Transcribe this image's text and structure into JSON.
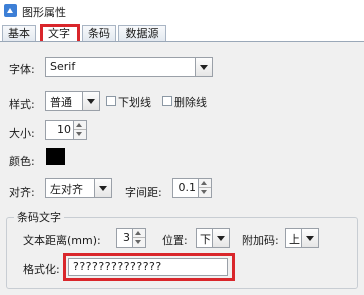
{
  "window": {
    "title": "图形属性",
    "icon": "app-icon"
  },
  "tabs": [
    {
      "label": "基本"
    },
    {
      "label": "文字",
      "active": true
    },
    {
      "label": "条码"
    },
    {
      "label": "数据源"
    }
  ],
  "font": {
    "label": "字体:",
    "value": "Serif"
  },
  "style": {
    "label": "样式:",
    "value": "普通",
    "underline_label": "下划线",
    "strikethrough_label": "删除线"
  },
  "size": {
    "label": "大小:",
    "value": "10"
  },
  "color": {
    "label": "颜色:",
    "value": "#000000"
  },
  "align": {
    "label": "对齐:",
    "value": "左对齐",
    "spacing_label": "字间距:",
    "spacing_value": "0.1"
  },
  "barcode_text": {
    "group_title": "条码文字",
    "distance_label": "文本距离(mm):",
    "distance_value": "3",
    "position_label": "位置:",
    "position_value": "下",
    "addon_label": "附加码:",
    "addon_value": "上",
    "format_label": "格式化:",
    "format_value": "??????????????"
  },
  "colors": {
    "highlight": "#d9262b",
    "panel_bg": "#f0f0f0"
  }
}
